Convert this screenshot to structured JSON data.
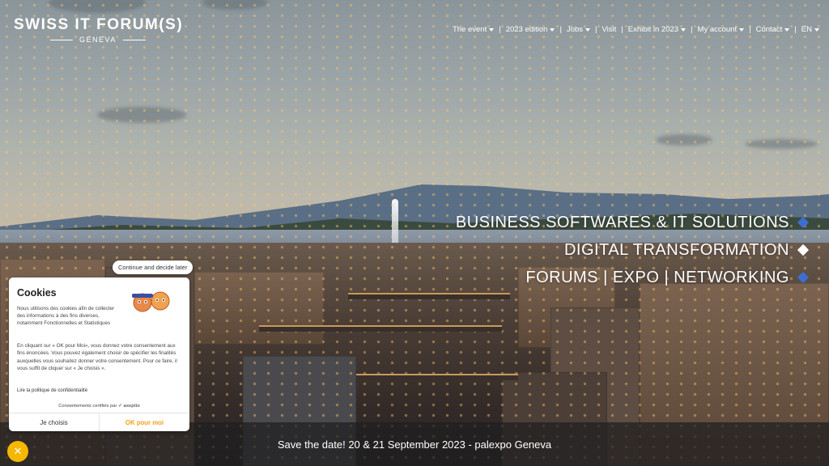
{
  "logo": {
    "main": "SWISS IT FORUM(S)",
    "sub": "GENEVA"
  },
  "nav": {
    "items": [
      {
        "label": "The event",
        "dropdown": true
      },
      {
        "label": "2023 edition",
        "dropdown": true
      },
      {
        "label": "Jobs",
        "dropdown": true
      },
      {
        "label": "Visit",
        "dropdown": false
      },
      {
        "label": "Exhibit in 2023",
        "dropdown": true
      },
      {
        "label": "My account",
        "dropdown": true
      },
      {
        "label": "Contact",
        "dropdown": true
      },
      {
        "label": "EN",
        "dropdown": true
      }
    ],
    "separator": "|"
  },
  "taglines": [
    {
      "text": "BUSINESS SOFTWARES & IT SOLUTIONS",
      "diamond_color": "#3d6ecf"
    },
    {
      "text": "DIGITAL TRANSFORMATION",
      "diamond_color": "#ffffff"
    },
    {
      "text": "FORUMS | EXPO | NETWORKING",
      "diamond_color": "#3d6ecf"
    }
  ],
  "save_the_date": "Save the date! 20 & 21 September 2023 - palexpo Geneva",
  "cookie": {
    "continue_label": "Continue and decide later",
    "title": "Cookies",
    "text1": "Nous utilisons des cookies afin de collecter des informations à des fins diverses, notamment Fonctionnelles et Statistiques",
    "text2": "En cliquant sur « OK pour Moi», vous donnez votre consentement aux fins énoncées. Vous pouvez également choisir de spécifier les finalités auxquelles vous souhaitez donner votre consentement. Pour ce faire, il vous suffit de cliquer sur « Je choisis ».",
    "policy_link": "Lire la politique de confidentialité",
    "certified": "Consentements certifiés par",
    "certified_brand": "axeptio",
    "choose_label": "Je choisis",
    "ok_label": "OK pour moi",
    "ok_color": "#f0a21c"
  },
  "axeptio_badge_icon": "close-icon",
  "colors": {
    "accent_blue": "#3d6ecf",
    "badge_yellow": "#f5b700"
  }
}
